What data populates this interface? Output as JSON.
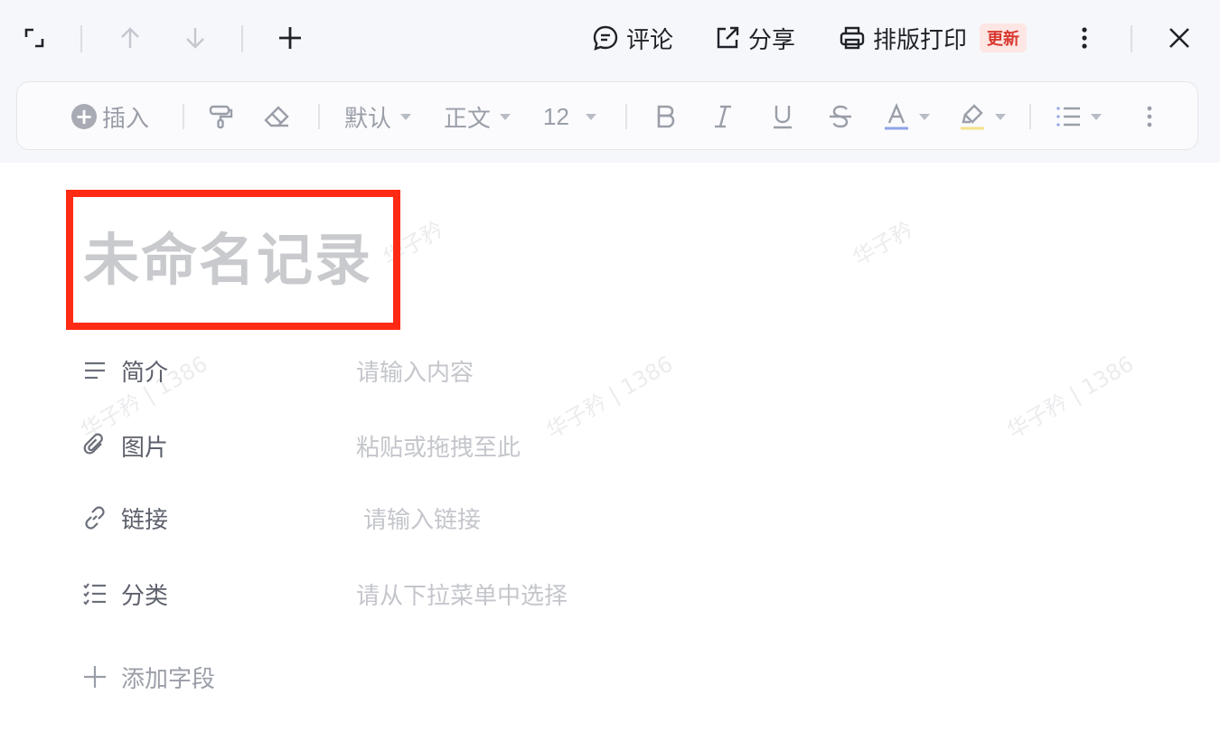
{
  "topbar": {
    "comment_label": "评论",
    "share_label": "分享",
    "print_label": "排版打印",
    "print_badge": "更新"
  },
  "format_toolbar": {
    "insert_label": "插入",
    "font_family": "默认",
    "paragraph_style": "正文",
    "font_size": "12"
  },
  "record": {
    "title": "未命名记录"
  },
  "fields": [
    {
      "label": "简介",
      "placeholder": "请输入内容",
      "icon": "text-lines-icon"
    },
    {
      "label": "图片",
      "placeholder": "粘贴或拖拽至此",
      "icon": "paperclip-icon"
    },
    {
      "label": "链接",
      "placeholder": "请输入链接",
      "icon": "link-icon"
    },
    {
      "label": "分类",
      "placeholder": "请从下拉菜单中选择",
      "icon": "checklist-icon"
    }
  ],
  "add_field_label": "添加字段",
  "watermarks": [
    "华子矜",
    "华子矜",
    "华子矜 | 1386",
    "华子矜 | 1386",
    "华子矜 | 1386"
  ],
  "colors": {
    "highlight_box": "#ff2a14",
    "badge_bg": "#fde6e3",
    "badge_text": "#d83931",
    "font_color_underline": "#8fa4e8",
    "highlight_underline": "#f5e08a"
  }
}
